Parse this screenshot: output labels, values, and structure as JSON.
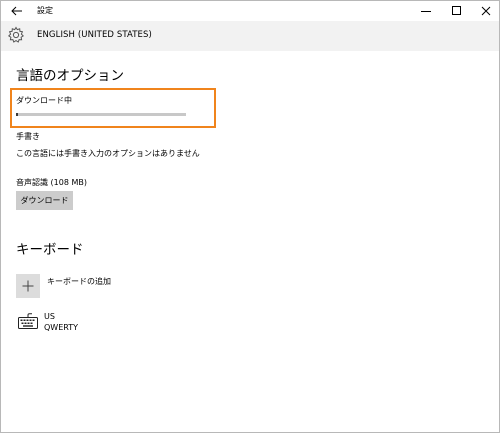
{
  "titlebar": {
    "title": "設定"
  },
  "header": {
    "title": "ENGLISH (UNITED STATES)"
  },
  "language_options": {
    "title": "言語のオプション",
    "download_status": "ダウンロード中",
    "download_progress_fraction": 0.01,
    "handwriting_label": "手書き",
    "handwriting_note": "この言語には手書き入力のオプションはありません",
    "speech_label": "音声認識 (108 MB)",
    "download_button": "ダウンロード"
  },
  "keyboard": {
    "title": "キーボード",
    "add_label": "キーボードの追加",
    "items": [
      {
        "name": "US",
        "layout": "QWERTY"
      }
    ]
  },
  "colors": {
    "highlight_border": "#f0841c",
    "header_band": "#f2f2f2",
    "button_bg": "#cccccc"
  },
  "icons": {
    "back": "back-arrow-icon",
    "minimize": "minimize-icon",
    "maximize": "maximize-icon",
    "close": "close-icon",
    "settings": "gear-icon",
    "add": "plus-icon",
    "keyboard": "keyboard-icon"
  }
}
